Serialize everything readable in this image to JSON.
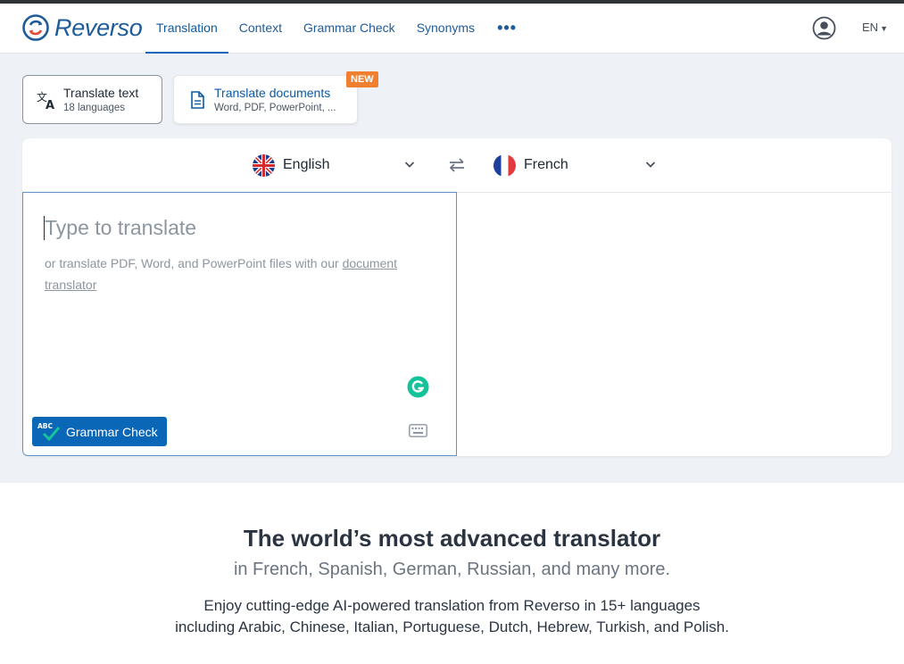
{
  "brand": {
    "name": "Reverso"
  },
  "nav": {
    "items": [
      {
        "label": "Translation",
        "active": true
      },
      {
        "label": "Context",
        "active": false
      },
      {
        "label": "Grammar Check",
        "active": false
      },
      {
        "label": "Synonyms",
        "active": false
      }
    ],
    "more_label": "•••"
  },
  "header": {
    "language": "EN"
  },
  "modes": {
    "text": {
      "title": "Translate text",
      "subtitle": "18 languages"
    },
    "documents": {
      "title": "Translate documents",
      "subtitle": "Word, PDF, PowerPoint, ...",
      "badge": "NEW"
    }
  },
  "translator": {
    "source_language": "English",
    "target_language": "French",
    "placeholder": "Type to translate",
    "hint_prefix": "or translate PDF, Word, and PowerPoint files with our ",
    "hint_link": "document translator",
    "grammar_button": "Grammar Check",
    "grammar_icon_text": "ABC"
  },
  "promo": {
    "title": "The world’s most advanced translator",
    "subtitle": "in French, Spanish, German, Russian, and many more.",
    "line1": "Enjoy cutting-edge AI-powered translation from Reverso in 15+ languages",
    "line2": "including Arabic, Chinese, Italian, Portuguese, Dutch, Hebrew, Turkish, and Polish."
  },
  "colors": {
    "brand_blue": "#1e5b99",
    "button_blue": "#0a66b7",
    "badge_orange": "#f07f2f",
    "page_bg": "#eef2f6"
  }
}
